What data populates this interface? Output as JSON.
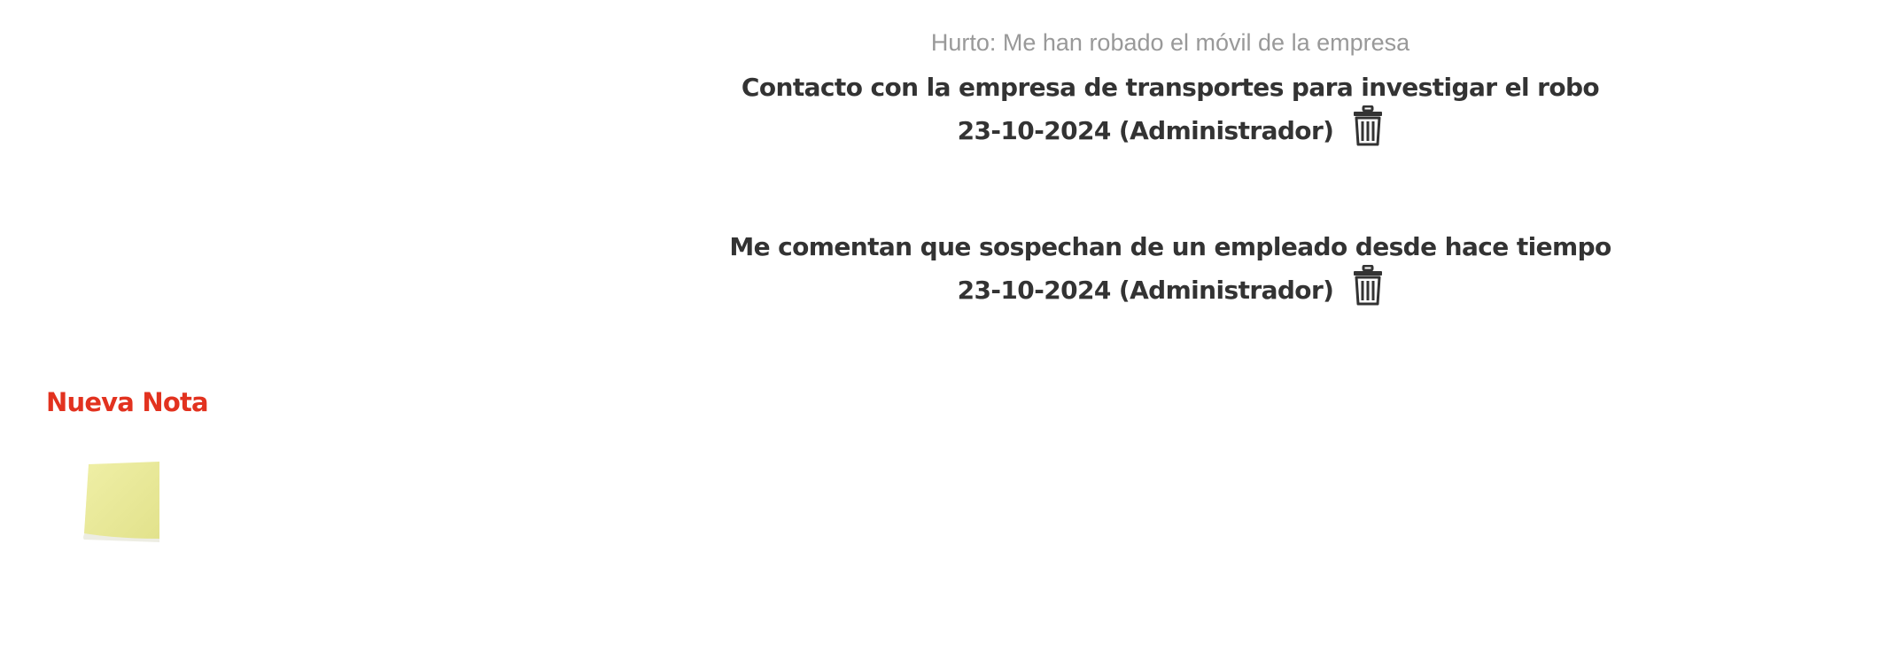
{
  "subject": "Hurto: Me han robado el móvil de la empresa",
  "notes": [
    {
      "text": "Contacto con la empresa de transportes para investigar el robo",
      "meta": "23-10-2024 (Administrador)",
      "delete_icon": "trash-icon"
    },
    {
      "text": "Me comentan que sospechan de un empleado desde hace tiempo",
      "meta": "23-10-2024 (Administrador)",
      "delete_icon": "trash-icon"
    }
  ],
  "new_note": {
    "title": "Nueva Nota",
    "icon": "sticky-note-icon",
    "title_color": "#e2321f",
    "note_color": "#eeeea0"
  }
}
